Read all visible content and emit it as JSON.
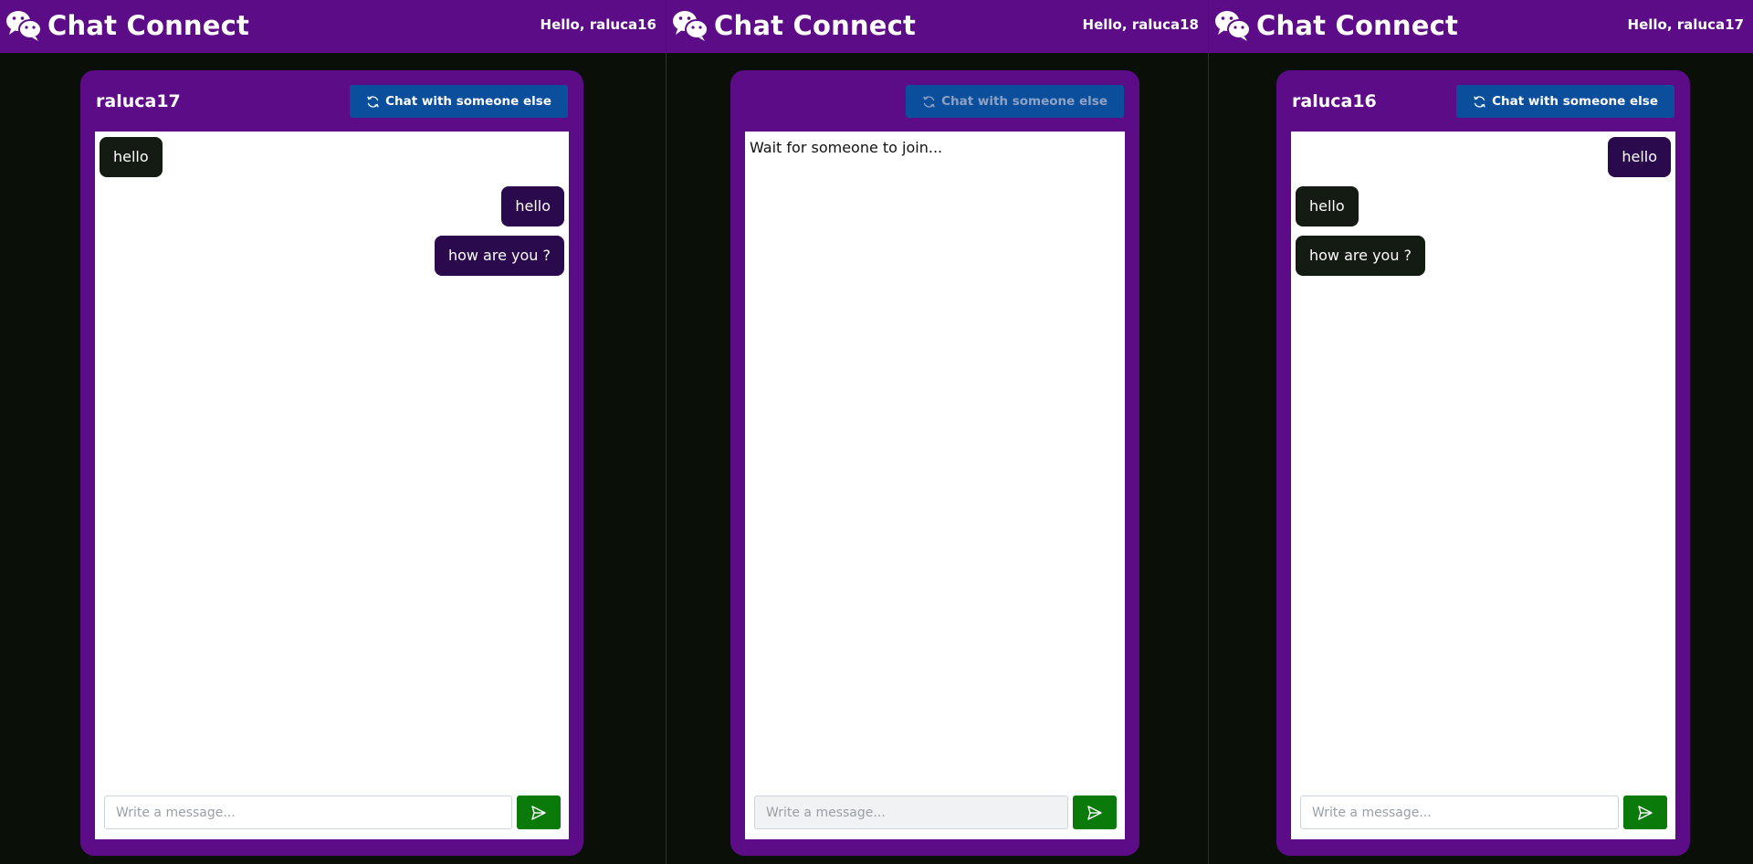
{
  "app": {
    "brand_name": "Chat Connect"
  },
  "panes": [
    {
      "greeting": "Hello, raluca16",
      "partner_name": "raluca17",
      "switch_label": "Chat with someone else",
      "messages": [
        {
          "text": "hello",
          "direction": "received"
        },
        {
          "text": "hello",
          "direction": "sent"
        },
        {
          "text": "how are you ?",
          "direction": "sent"
        }
      ],
      "input_placeholder": "Write a message..."
    },
    {
      "greeting": "Hello, raluca18",
      "partner_name": "",
      "switch_label": "Chat with someone else",
      "status_text": "Wait for someone to join...",
      "input_placeholder": "Write a message..."
    },
    {
      "greeting": "Hello, raluca17",
      "partner_name": "raluca16",
      "switch_label": "Chat with someone else",
      "messages": [
        {
          "text": "hello",
          "direction": "sent"
        },
        {
          "text": "hello",
          "direction": "received"
        },
        {
          "text": "how are you ?",
          "direction": "received"
        }
      ],
      "input_placeholder": "Write a message..."
    }
  ],
  "colors": {
    "navbar": "#5c0c86",
    "card": "#5c0c86",
    "page_background": "#0a1008",
    "switch_button": "#0b4f9c",
    "send_button": "#0a7a0a",
    "sent_bubble": "#2a0a4d",
    "received_bubble": "#131b12"
  },
  "icons": {
    "brand": "wechat-icon",
    "switch": "refresh-icon",
    "send": "send-icon"
  }
}
